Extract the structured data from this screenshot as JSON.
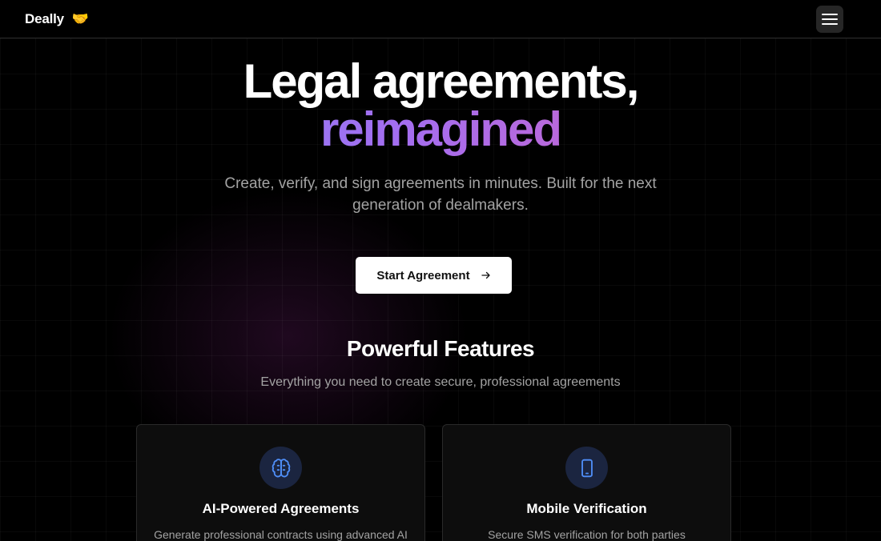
{
  "header": {
    "brand": "Deally",
    "brand_emoji": "🤝",
    "menu_icon": "hamburger-menu-icon"
  },
  "hero": {
    "title_line1": "Legal agreements,",
    "title_line2": "reimagined",
    "subtitle": "Create, verify, and sign agreements in minutes. Built for the next generation of dealmakers.",
    "cta_label": "Start Agreement",
    "cta_icon": "arrow-right-icon"
  },
  "features": {
    "title": "Powerful Features",
    "subtitle": "Everything you need to create secure, professional agreements",
    "cards": [
      {
        "title": "AI-Powered Agreements",
        "description": "Generate professional contracts using advanced AI",
        "icon": "brain-icon"
      },
      {
        "title": "Mobile Verification",
        "description": "Secure SMS verification for both parties",
        "icon": "smartphone-icon"
      }
    ]
  },
  "colors": {
    "background": "#000000",
    "accent_gradient_start": "#7b8cf6",
    "accent_gradient_end": "#e35fb2",
    "icon_blue": "#4f8ef7",
    "icon_circle": "#1b2540"
  }
}
